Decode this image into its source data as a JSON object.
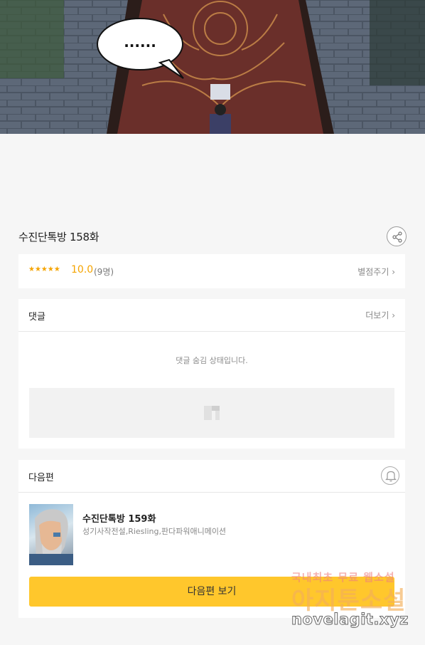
{
  "comic": {
    "speech_text": "......"
  },
  "episode": {
    "title": "수진단톡방 158화"
  },
  "rating": {
    "stars": "★★★★★",
    "score": "10.0",
    "count": "(9명)",
    "rate_link": "별점주기 ›"
  },
  "comments": {
    "title": "댓글",
    "more_link": "더보기 ›",
    "hidden_message": "댓글 숨김 상태입니다."
  },
  "next": {
    "title": "다음편",
    "episode_title": "수진단톡방 159화",
    "authors": "성기사작전설,Riesling,판다파워애니메이션",
    "button_label": "다음편 보기"
  },
  "watermark": {
    "line1": "국내최초 무료 웹소설",
    "line2": "아지툰소설",
    "line3": "novelagit.xyz"
  },
  "colors": {
    "accent": "#ffc72c",
    "star": "#f5a400",
    "background": "#f6f6f6"
  }
}
